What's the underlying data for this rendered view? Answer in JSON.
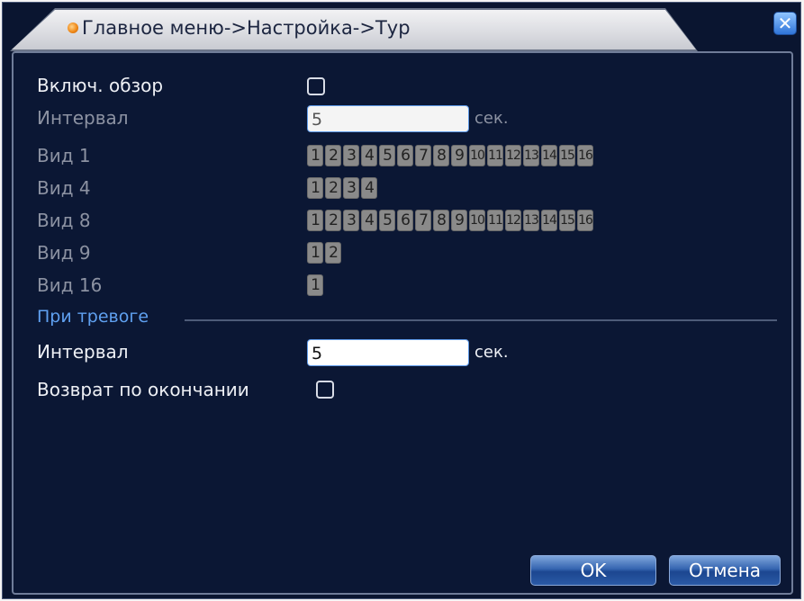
{
  "window": {
    "title": "Главное меню->Настройка->Тур",
    "close_glyph": "✕",
    "close_icon": "close-icon",
    "title_dot_icon": "menu-dot-icon"
  },
  "tour": {
    "enable_label": "Включ. обзор",
    "enable_checked": false,
    "interval_label": "Интервал",
    "interval_value": "5",
    "interval_unit": "сек.",
    "views": [
      {
        "label": "Вид 1",
        "channels": [
          "1",
          "2",
          "3",
          "4",
          "5",
          "6",
          "7",
          "8",
          "9",
          "10",
          "11",
          "12",
          "13",
          "14",
          "15",
          "16"
        ]
      },
      {
        "label": "Вид 4",
        "channels": [
          "1",
          "2",
          "3",
          "4"
        ]
      },
      {
        "label": "Вид 8",
        "channels": [
          "1",
          "2",
          "3",
          "4",
          "5",
          "6",
          "7",
          "8",
          "9",
          "10",
          "11",
          "12",
          "13",
          "14",
          "15",
          "16"
        ]
      },
      {
        "label": "Вид 9",
        "channels": [
          "1",
          "2"
        ]
      },
      {
        "label": "Вид 16",
        "channels": [
          "1"
        ]
      }
    ]
  },
  "alarm": {
    "section_label": "При тревоге",
    "interval_label": "Интервал",
    "interval_value": "5",
    "interval_unit": "сек.",
    "return_label": "Возврат по окончании",
    "return_checked": false
  },
  "buttons": {
    "ok": "OK",
    "cancel": "Отмена"
  },
  "colors": {
    "background": "#0b1734",
    "label_active": "#eef0f5",
    "label_dim": "#8c92a2",
    "section": "#5fa0f0",
    "chip": "#8a8a8a",
    "button": "#2a5aa6"
  }
}
